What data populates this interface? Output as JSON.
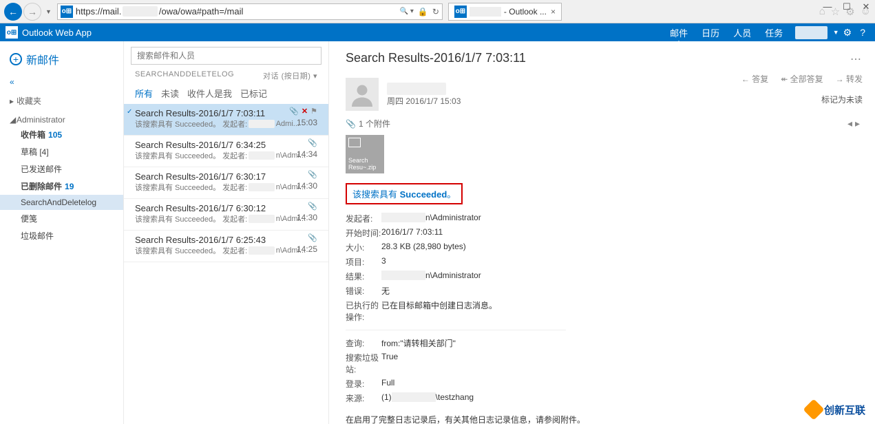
{
  "window_controls": {
    "min": "—",
    "max": "☐",
    "close": "✕"
  },
  "browser": {
    "url_prefix": "https://mail.",
    "url_suffix": "/owa/owa#path=/mail",
    "tab_suffix": " - Outlook ...",
    "icons": {
      "search": "🔍",
      "refresh": "↻",
      "lock": "🔒",
      "home": "⌂",
      "star": "☆",
      "gear": "⚙",
      "smile": "☺"
    }
  },
  "header": {
    "app": "Outlook Web App",
    "nav": {
      "mail": "邮件",
      "calendar": "日历",
      "people": "人员",
      "tasks": "任务"
    },
    "gear": "⚙",
    "help": "?"
  },
  "left": {
    "new_mail": "新邮件",
    "collapse": "«",
    "favorites": "收藏夹",
    "admin": "Administrator",
    "folders": {
      "inbox": "收件箱",
      "inbox_count": "105",
      "drafts": "草稿 [4]",
      "sent": "已发送邮件",
      "deleted": "已删除邮件",
      "deleted_count": "19",
      "searchlog": "SearchAndDeletelog",
      "notes": "便笺",
      "junk": "垃圾邮件"
    }
  },
  "mid": {
    "search_placeholder": "搜索邮件和人员",
    "header_name": "SEARCHANDDELETELOG",
    "sort": "对话 (按日期)",
    "filters": {
      "all": "所有",
      "unread": "未读",
      "tome": "收件人是我",
      "flagged": "已标记"
    },
    "messages": [
      {
        "subject": "Search Results-2016/1/7 7:03:11",
        "preview_pre": "该搜索具有 Succeeded。 发起者:",
        "preview_post": "Admi...",
        "time": "15:03",
        "selected": true
      },
      {
        "subject": "Search Results-2016/1/7 6:34:25",
        "preview_pre": "该搜索具有 Succeeded。 发起者:",
        "preview_post": "n\\Admi...",
        "time": "14:34"
      },
      {
        "subject": "Search Results-2016/1/7 6:30:17",
        "preview_pre": "该搜索具有 Succeeded。 发起者:",
        "preview_post": "n\\Admi...",
        "time": "14:30"
      },
      {
        "subject": "Search Results-2016/1/7 6:30:12",
        "preview_pre": "该搜索具有 Succeeded。 发起者:",
        "preview_post": "n\\Admi...",
        "time": "14:30"
      },
      {
        "subject": "Search Results-2016/1/7 6:25:43",
        "preview_pre": "该搜索具有 Succeeded。 发起者:",
        "preview_post": "n\\Admi...",
        "time": "14:25"
      }
    ]
  },
  "read": {
    "title": "Search Results-2016/1/7 7:03:11",
    "actions": {
      "reply": "答复",
      "reply_all": "全部答复",
      "forward": "转发",
      "mark_unread": "标记为未读",
      "reply_icon": "←",
      "reply_all_icon": "↞",
      "forward_icon": "→"
    },
    "date": "周四 2016/1/7 15:03",
    "attach_label": "1 个附件",
    "attach_name": "Search Resu~.zip",
    "status_pre": "该搜索具有 ",
    "status_word": "Succeeded",
    "status_post": "。",
    "details1": [
      {
        "lab": "发起者:",
        "val_post": "n\\Administrator",
        "blur": true
      },
      {
        "lab": "开始时间:",
        "val": "2016/1/7 7:03:11"
      },
      {
        "lab": "大小:",
        "val": "28.3 KB (28,980 bytes)"
      },
      {
        "lab": "项目:",
        "val": "3"
      },
      {
        "lab": "结果:",
        "val_post": "n\\Administrator",
        "blur": true
      },
      {
        "lab": "错误:",
        "val": "无"
      },
      {
        "lab": "已执行的操作:",
        "val": "已在目标邮箱中创建日志消息。"
      }
    ],
    "details2": [
      {
        "lab": "查询:",
        "val": "from:\"请转相关部门\""
      },
      {
        "lab": "搜索垃圾站:",
        "val": "True"
      },
      {
        "lab": "登录:",
        "val": "Full"
      },
      {
        "lab": "来源:",
        "val_pre": "(1)",
        "val_post": "\\testzhang",
        "blur": true
      }
    ],
    "footer": "在启用了完整日志记录后，有关其他日志记录信息，请参阅附件。",
    "watermark": "创新互联"
  }
}
